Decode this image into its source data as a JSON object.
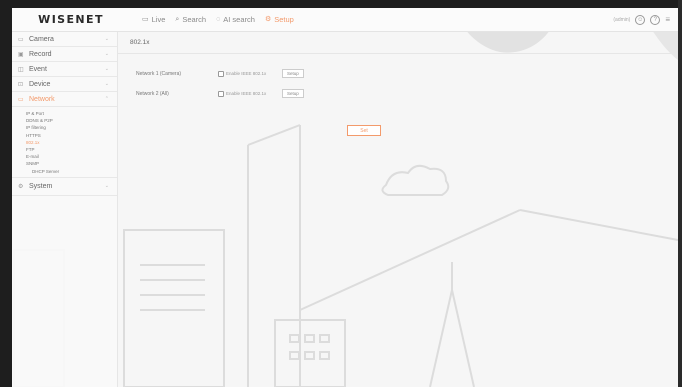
{
  "brand": "WISENET",
  "nav": [
    {
      "icon": "monitor-icon",
      "label": "Live",
      "active": false
    },
    {
      "icon": "search-icon",
      "label": "Search",
      "active": false
    },
    {
      "icon": "ai-icon",
      "label": "AI search",
      "active": false
    },
    {
      "icon": "gear-icon",
      "label": "Setup",
      "active": true
    }
  ],
  "user": "(admin)",
  "sidebar": {
    "camera": "Camera",
    "record": "Record",
    "event": "Event",
    "device": "Device",
    "network": "Network",
    "network_sub": [
      "IP & Port",
      "DDNS & P2P",
      "IP filtering",
      "HTTPS",
      "802.1x",
      "FTP",
      "E-mail",
      "SNMP",
      "DHCP Server"
    ],
    "system": "System"
  },
  "page": {
    "title": "802.1x",
    "rows": [
      {
        "label": "Network 1 (Camera)",
        "checkbox_label": "Enable IEEE 802.1x",
        "button": "Setup"
      },
      {
        "label": "Network 2 (All)",
        "checkbox_label": "Enable IEEE 802.1x",
        "button": "Setup"
      }
    ],
    "set_button": "Set"
  },
  "colors": {
    "accent": "#f39a6b",
    "frame": "#1e1e1e",
    "background": "#f6f6f6"
  }
}
